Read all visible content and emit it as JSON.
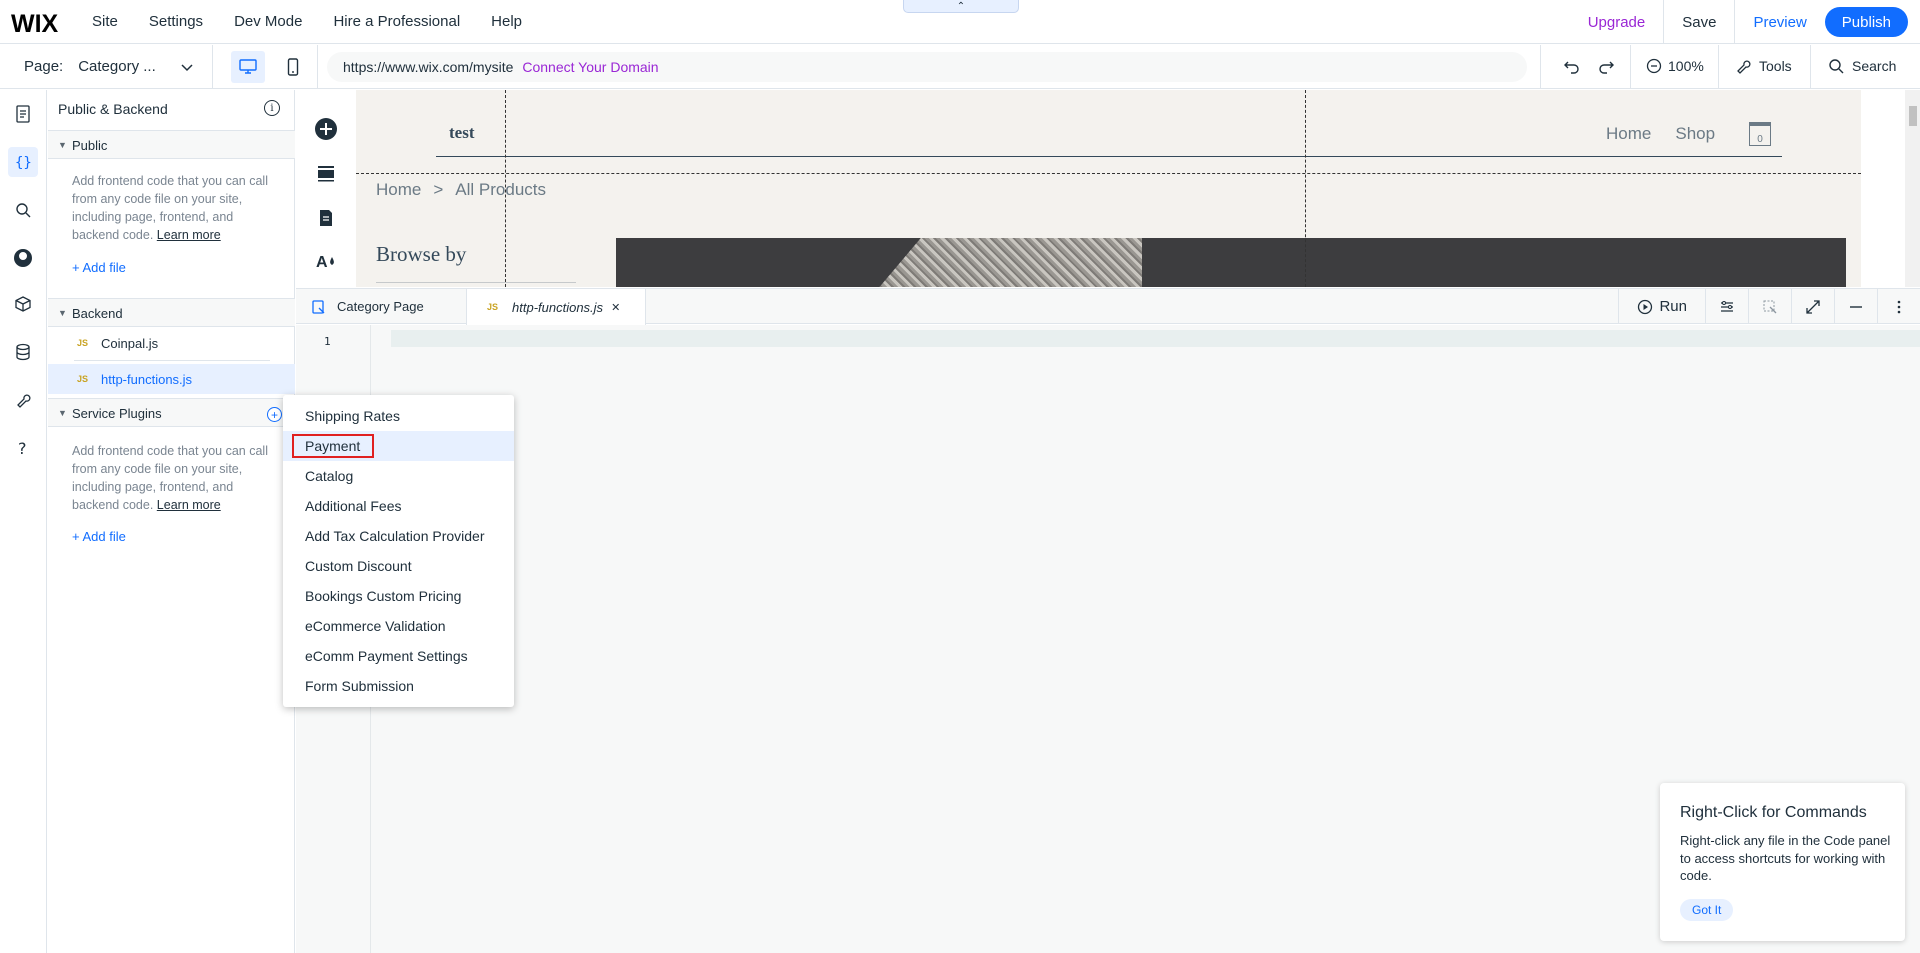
{
  "topbar": {
    "logo": "WIX",
    "menu": [
      "Site",
      "Settings",
      "Dev Mode",
      "Hire a Professional",
      "Help"
    ],
    "collapse_glyph": "⌃",
    "upgrade": "Upgrade",
    "save": "Save",
    "preview": "Preview",
    "publish": "Publish"
  },
  "secondbar": {
    "page_label": "Page:",
    "page_value": "Category ...",
    "url": "https://www.wix.com/mysite",
    "connect_domain": "Connect Your Domain",
    "zoom": "100%",
    "tools": "Tools",
    "search": "Search"
  },
  "panel": {
    "title": "Public & Backend",
    "info_glyph": "i",
    "public": {
      "header": "Public",
      "desc_text": "Add frontend code that you can call from any code file on your site, including page, frontend, and backend code.",
      "learn_more": "Learn more",
      "add_file": "+ Add file"
    },
    "backend": {
      "header": "Backend",
      "files": [
        {
          "badge": "JS",
          "name": "Coinpal.js"
        },
        {
          "badge": "JS",
          "name": "http-functions.js"
        }
      ]
    },
    "service_plugins": {
      "header": "Service Plugins",
      "plus_glyph": "+",
      "desc_text": "Add frontend code that you can call from any code file on your site, including page, frontend, and backend code.",
      "learn_more": "Learn more",
      "add_file": "+ Add file"
    }
  },
  "site": {
    "title": "test",
    "nav": [
      "Home",
      "Shop"
    ],
    "cart_count": "0",
    "breadcrumb": [
      "Home",
      "All Products"
    ],
    "breadcrumb_sep": ">",
    "browse_by": "Browse by"
  },
  "editor": {
    "tabs": [
      {
        "name": "Category Page"
      },
      {
        "badge": "JS",
        "name": "http-functions.js",
        "close": "✕"
      }
    ],
    "run_label": "Run",
    "line_numbers": [
      "1"
    ]
  },
  "service_menu": {
    "items": [
      "Shipping Rates",
      "Payment",
      "Catalog",
      "Additional Fees",
      "Add Tax Calculation Provider",
      "Custom Discount",
      "Bookings Custom Pricing",
      "eCommerce Validation",
      "eComm Payment Settings",
      "Form Submission"
    ],
    "highlighted_index": 1
  },
  "tip": {
    "title": "Right-Click for Commands",
    "body": "Right-click any file in the Code panel to access shortcuts for working with code.",
    "button": "Got It"
  },
  "colors": {
    "accent": "#116dff",
    "upgrade_purple": "#9a27d5",
    "highlight_red": "#e02020"
  }
}
